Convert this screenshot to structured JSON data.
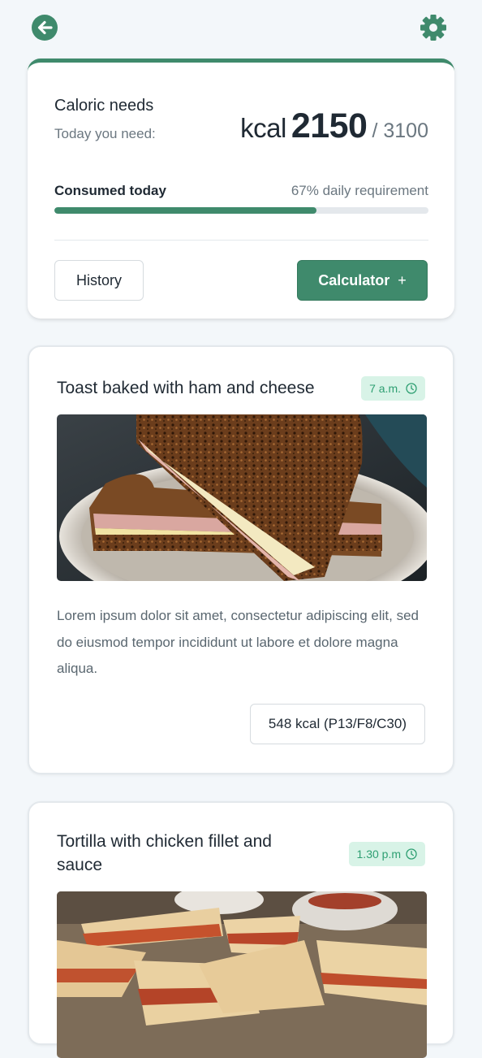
{
  "header": {
    "back_icon": "arrow-left-circle-icon",
    "settings_icon": "gear-icon"
  },
  "colors": {
    "accent": "#3f8a6c",
    "badge_bg": "#d8f3e7",
    "badge_text": "#2e9f72",
    "page_bg": "#f3f7fa"
  },
  "summary": {
    "title": "Caloric needs",
    "subtitle": "Today you need:",
    "kcal_unit": "kcal",
    "kcal_value": "2150",
    "kcal_total": "/ 3100",
    "consumed_label": "Consumed today",
    "consumed_pct_text": "67% daily requirement",
    "progress_percent": 70,
    "history_label": "History",
    "calculator_label": "Calculator",
    "calculator_icon": "plus-icon"
  },
  "meals": [
    {
      "title": "Toast baked with ham and cheese",
      "time": "7 a.m.",
      "time_icon": "clock-icon",
      "image": "toast-ham-cheese-photo",
      "description": "Lorem ipsum dolor sit amet, consectetur adipiscing elit, sed do eiusmod tempor incididunt ut labore et dolore magna aliqua.",
      "kcal": "548 kcal (P13/F8/C30)"
    },
    {
      "title": "Tortilla with chicken fillet and sauce",
      "time": "1.30 p.m",
      "time_icon": "clock-icon",
      "image": "tortilla-chicken-photo"
    }
  ]
}
